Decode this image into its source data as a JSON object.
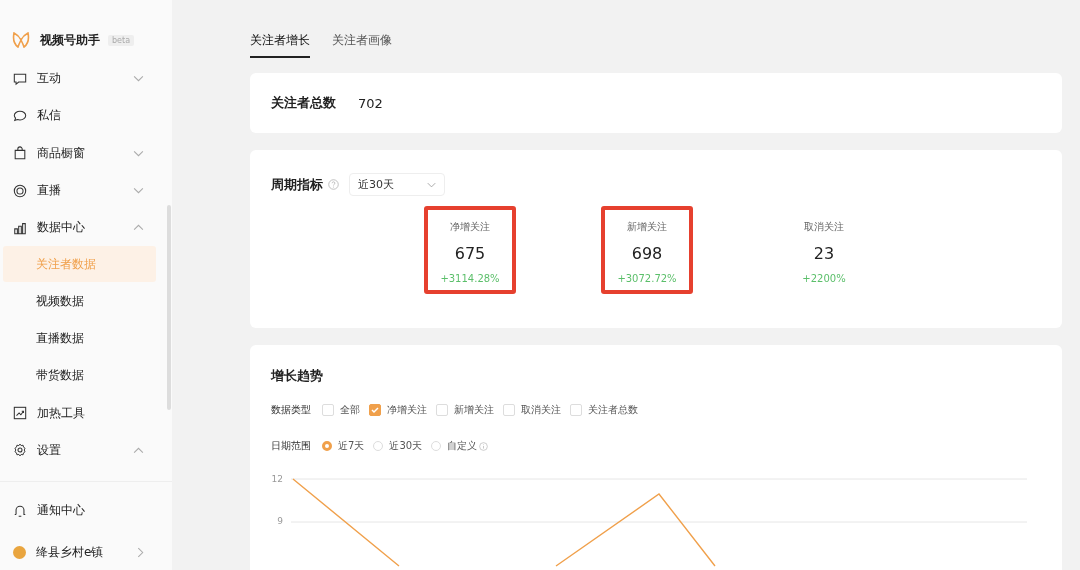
{
  "sidebar": {
    "logo": {
      "title": "视频号助手",
      "badge": "beta"
    },
    "items": [
      {
        "label": "互动",
        "expanded": false
      },
      {
        "label": "私信"
      },
      {
        "label": "商品橱窗",
        "expanded": false
      },
      {
        "label": "直播",
        "expanded": false
      },
      {
        "label": "数据中心",
        "expanded": true,
        "children": [
          {
            "label": "关注者数据",
            "selected": true
          },
          {
            "label": "视频数据",
            "selected": false
          },
          {
            "label": "直播数据",
            "selected": false
          },
          {
            "label": "带货数据",
            "selected": false
          }
        ]
      },
      {
        "label": "加热工具"
      },
      {
        "label": "设置",
        "expanded": true
      }
    ],
    "notification": "通知中心",
    "account": "绛县乡村e镇"
  },
  "tabs": [
    {
      "label": "关注者增长",
      "selected": true
    },
    {
      "label": "关注者画像",
      "selected": false
    }
  ],
  "total": {
    "label": "关注者总数",
    "value": "702"
  },
  "period": {
    "title": "周期指标",
    "range": "近30天",
    "metrics": [
      {
        "label": "净增关注",
        "value": "675",
        "change": "+3114.28%",
        "highlighted": true
      },
      {
        "label": "新增关注",
        "value": "698",
        "change": "+3072.72%",
        "highlighted": true
      },
      {
        "label": "取消关注",
        "value": "23",
        "change": "+2200%",
        "highlighted": false
      }
    ]
  },
  "trend": {
    "title": "增长趋势",
    "data_type": {
      "label": "数据类型",
      "options": [
        {
          "label": "全部",
          "checked": false
        },
        {
          "label": "净增关注",
          "checked": true
        },
        {
          "label": "新增关注",
          "checked": false
        },
        {
          "label": "取消关注",
          "checked": false
        },
        {
          "label": "关注者总数",
          "checked": false
        }
      ]
    },
    "date_range": {
      "label": "日期范围",
      "options": [
        {
          "label": "近7天",
          "selected": true,
          "info": false
        },
        {
          "label": "近30天",
          "selected": false,
          "info": false
        },
        {
          "label": "自定义",
          "selected": false,
          "info": true
        }
      ]
    },
    "y_labels": [
      "12",
      "9"
    ]
  }
}
